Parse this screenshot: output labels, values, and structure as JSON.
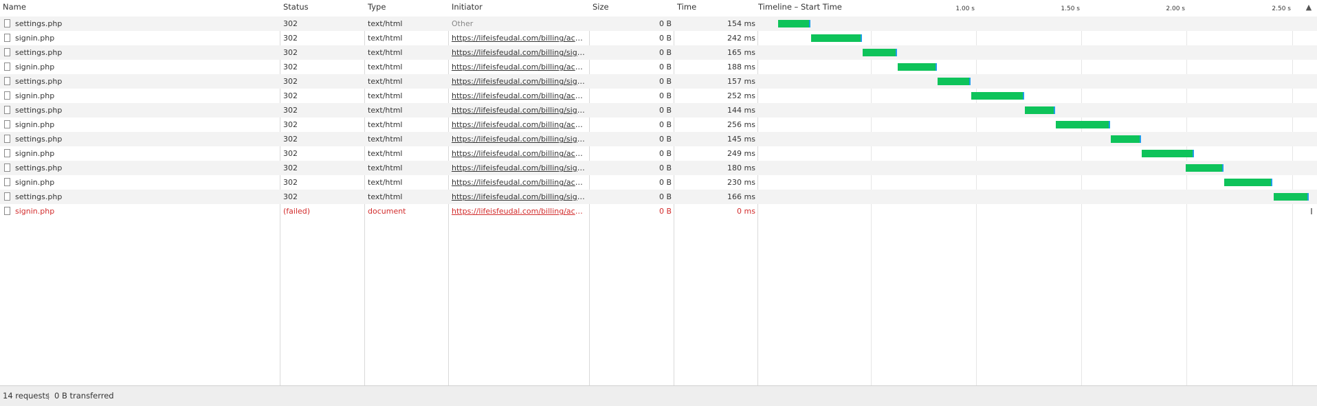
{
  "columns": {
    "name": "Name",
    "status": "Status",
    "type": "Type",
    "initiator": "Initiator",
    "size": "Size",
    "time": "Time",
    "timeline": "Timeline – Start Time"
  },
  "timeline_ticks": [
    "1.00 s",
    "1.50 s",
    "2.00 s",
    "2.50 s"
  ],
  "sort_indicator": "▲",
  "rows": [
    {
      "name": "settings.php",
      "status": "302",
      "type": "text/html",
      "initiator": "Other",
      "size": "0 B",
      "time": "154 ms",
      "start_s": 0.06,
      "duration_s": 0.154
    },
    {
      "name": "signin.php",
      "status": "302",
      "type": "text/html",
      "initiator": "https://lifeisfeudal.com/billing/account...",
      "size": "0 B",
      "time": "242 ms",
      "start_s": 0.215,
      "duration_s": 0.242
    },
    {
      "name": "settings.php",
      "status": "302",
      "type": "text/html",
      "initiator": "https://lifeisfeudal.com/billing/signin.p...",
      "size": "0 B",
      "time": "165 ms",
      "start_s": 0.46,
      "duration_s": 0.165
    },
    {
      "name": "signin.php",
      "status": "302",
      "type": "text/html",
      "initiator": "https://lifeisfeudal.com/billing/account...",
      "size": "0 B",
      "time": "188 ms",
      "start_s": 0.626,
      "duration_s": 0.188
    },
    {
      "name": "settings.php",
      "status": "302",
      "type": "text/html",
      "initiator": "https://lifeisfeudal.com/billing/signin.p...",
      "size": "0 B",
      "time": "157 ms",
      "start_s": 0.818,
      "duration_s": 0.157
    },
    {
      "name": "signin.php",
      "status": "302",
      "type": "text/html",
      "initiator": "https://lifeisfeudal.com/billing/account...",
      "size": "0 B",
      "time": "252 ms",
      "start_s": 0.977,
      "duration_s": 0.252
    },
    {
      "name": "settings.php",
      "status": "302",
      "type": "text/html",
      "initiator": "https://lifeisfeudal.com/billing/signin.p...",
      "size": "0 B",
      "time": "144 ms",
      "start_s": 1.233,
      "duration_s": 0.144
    },
    {
      "name": "signin.php",
      "status": "302",
      "type": "text/html",
      "initiator": "https://lifeisfeudal.com/billing/account...",
      "size": "0 B",
      "time": "256 ms",
      "start_s": 1.38,
      "duration_s": 0.256
    },
    {
      "name": "settings.php",
      "status": "302",
      "type": "text/html",
      "initiator": "https://lifeisfeudal.com/billing/signin.p...",
      "size": "0 B",
      "time": "145 ms",
      "start_s": 1.64,
      "duration_s": 0.145
    },
    {
      "name": "signin.php",
      "status": "302",
      "type": "text/html",
      "initiator": "https://lifeisfeudal.com/billing/account...",
      "size": "0 B",
      "time": "249 ms",
      "start_s": 1.788,
      "duration_s": 0.249
    },
    {
      "name": "settings.php",
      "status": "302",
      "type": "text/html",
      "initiator": "https://lifeisfeudal.com/billing/signin.p...",
      "size": "0 B",
      "time": "180 ms",
      "start_s": 1.998,
      "duration_s": 0.18
    },
    {
      "name": "signin.php",
      "status": "302",
      "type": "text/html",
      "initiator": "https://lifeisfeudal.com/billing/account...",
      "size": "0 B",
      "time": "230 ms",
      "start_s": 2.18,
      "duration_s": 0.23
    },
    {
      "name": "settings.php",
      "status": "302",
      "type": "text/html",
      "initiator": "https://lifeisfeudal.com/billing/signin.p...",
      "size": "0 B",
      "time": "166 ms",
      "start_s": 2.415,
      "duration_s": 0.166
    },
    {
      "name": "signin.php",
      "status": "(failed)",
      "type": "document",
      "initiator": "https://lifeisfeudal.com/billing/account...",
      "size": "0 B",
      "time": "0 ms",
      "start_s": 2.6,
      "duration_s": 0.0,
      "failed": true
    }
  ],
  "footer": {
    "requests": "14 requests",
    "transferred": "0 B transferred"
  },
  "colors": {
    "bar_fill": "#0ec35a",
    "bar_edge": "#1f9ee8",
    "failed_text": "#d22b2b",
    "stripe": "#f3f3f3"
  }
}
